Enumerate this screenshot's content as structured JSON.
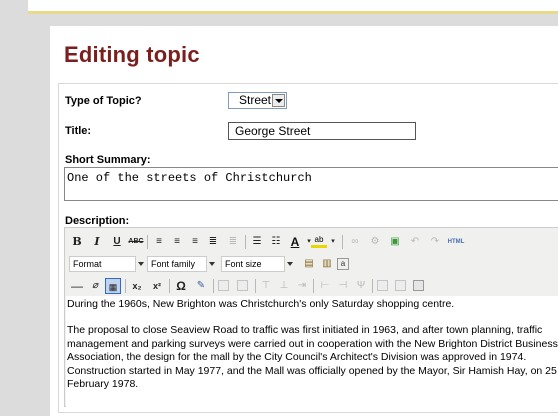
{
  "page": {
    "title": "Editing topic"
  },
  "form": {
    "type_label": "Type of Topic?",
    "type_value": "Street",
    "title_label": "Title:",
    "title_value": "George Street",
    "summary_label": "Short Summary:",
    "summary_value": "One of the streets of Christchurch",
    "description_label": "Description:"
  },
  "toolbar": {
    "bold": "B",
    "italic": "I",
    "underline": "U",
    "strike": "ABC",
    "format_combo": "Format",
    "font_family_combo": "Font family",
    "font_size_combo": "Font size",
    "html_button": "HTML",
    "omega": "Ω",
    "subscript": "x₂",
    "superscript": "x²",
    "text_color": "A",
    "highlight": "ab",
    "dash": "—"
  },
  "description": {
    "paragraphs": [
      "During the 1960s, New Brighton was Christchurch's only Saturday shopping centre.",
      "The proposal to close Seaview Road to traffic was first initiated in 1963, and after town planning, traffic",
      "management and parking surveys were carried out in cooperation with the New Brighton District Business",
      "Association, the design for the mall by the City Council's Architect's Division was approved in 1974.",
      "Construction started in May 1977, and the Mall was officially opened by the Mayor, Sir Hamish Hay, on 25",
      "February 1978."
    ]
  },
  "colors": {
    "title": "#7a1e1e",
    "background": "#dcdcdc",
    "accent_band": "#e9d98a",
    "toolbar_bg": "#f0f0ee"
  }
}
